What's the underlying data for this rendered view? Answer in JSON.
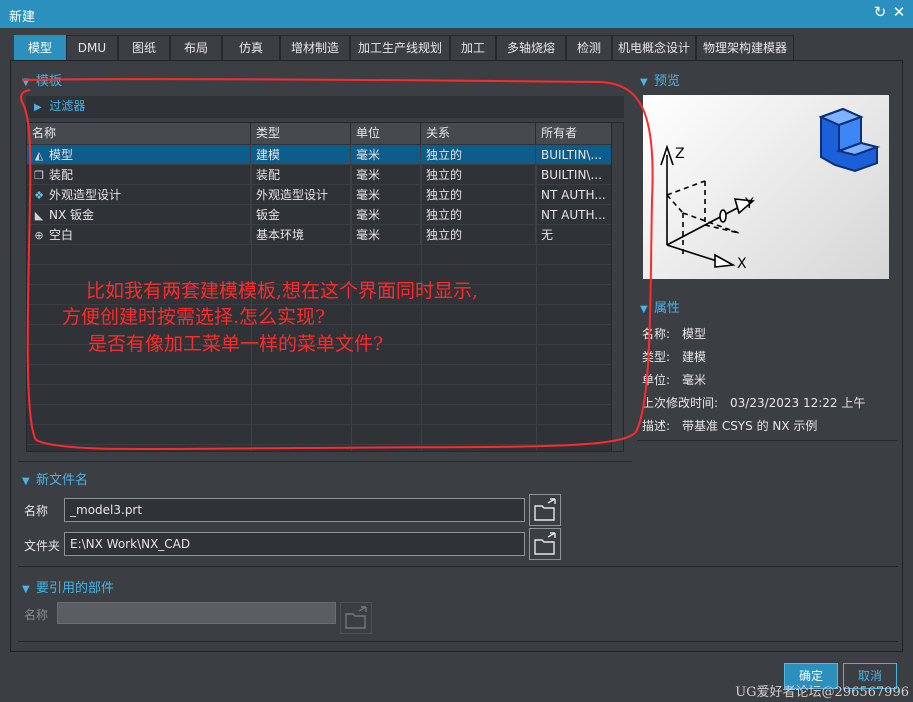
{
  "window": {
    "title": "新建"
  },
  "tabs": [
    "模型",
    "DMU",
    "图纸",
    "布局",
    "仿真",
    "增材制造",
    "加工生产线规划",
    "加工",
    "多轴烧熔",
    "检测",
    "机电概念设计",
    "物理架构建模器"
  ],
  "templates": {
    "section_label": "模板",
    "filter_label": "过滤器",
    "columns": [
      "名称",
      "类型",
      "单位",
      "关系",
      "所有者"
    ],
    "rows": [
      [
        "模型",
        "建模",
        "毫米",
        "独立的",
        "BUILTIN\\..."
      ],
      [
        "装配",
        "装配",
        "毫米",
        "独立的",
        "BUILTIN\\..."
      ],
      [
        "外观造型设计",
        "外观造型设计",
        "毫米",
        "独立的",
        "NT AUTH..."
      ],
      [
        "NX 钣金",
        "钣金",
        "毫米",
        "独立的",
        "NT AUTH..."
      ],
      [
        "空白",
        "基本环境",
        "毫米",
        "独立的",
        "无"
      ]
    ]
  },
  "preview": {
    "section_label": "预览",
    "axis_z": "Z",
    "axis_y": "Y",
    "axis_x": "X"
  },
  "properties": {
    "section_label": "属性",
    "items": [
      {
        "label": "名称:",
        "value": "模型"
      },
      {
        "label": "类型:",
        "value": "建模"
      },
      {
        "label": "单位:",
        "value": "毫米"
      },
      {
        "label": "上次修改时间:",
        "value": "03/23/2023 12:22 上午"
      },
      {
        "label": "描述:",
        "value": "带基准 CSYS 的 NX 示例"
      }
    ]
  },
  "new_file": {
    "section_label": "新文件名",
    "name_label": "名称",
    "name_value": "_model3.prt",
    "folder_label": "文件夹",
    "folder_value": "E:\\NX Work\\NX_CAD"
  },
  "referenced_part": {
    "section_label": "要引用的部件",
    "name_label": "名称",
    "name_value": ""
  },
  "buttons": {
    "ok": "确定",
    "cancel": "取消"
  },
  "annotation": {
    "line1": "比如我有两套建模模板,想在这个界面同时显示,",
    "line2": "方便创建时按需选择.怎么实现?",
    "line3": "是否有像加工菜单一样的菜单文件?"
  },
  "watermark": "UG爱好者论坛@296567996",
  "colors": {
    "accent": "#2b90be",
    "selected_row": "#0d5c8a",
    "annotation": "#ff2a2a"
  }
}
